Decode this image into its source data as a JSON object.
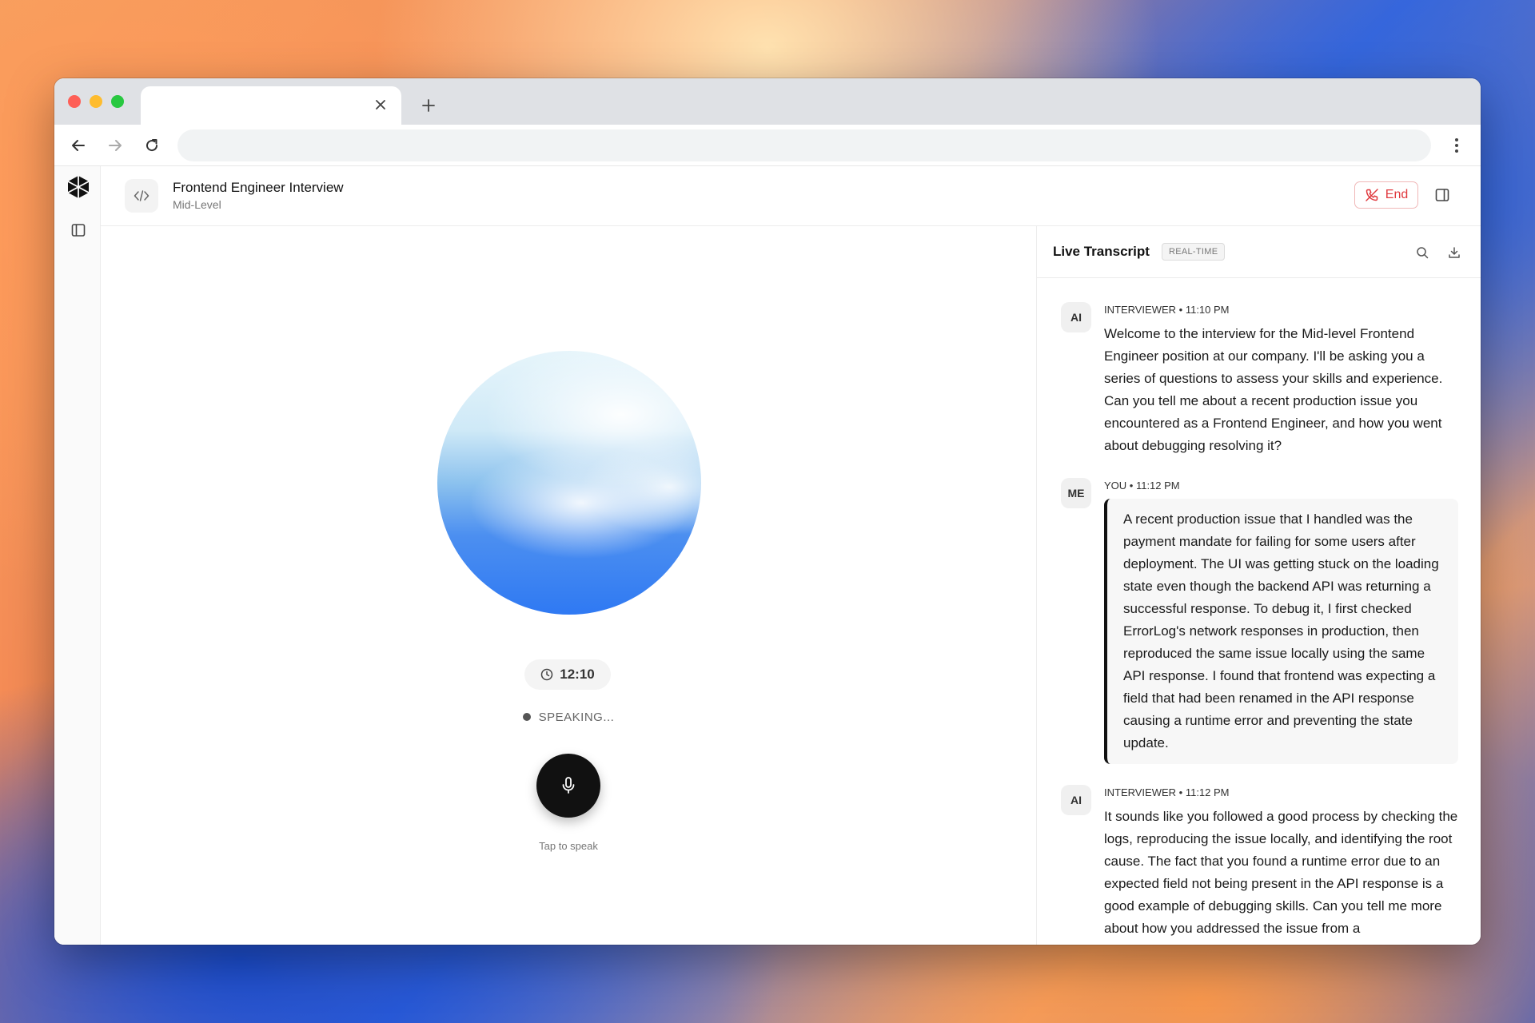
{
  "browser": {
    "tab_title": "",
    "url": ""
  },
  "header": {
    "title": "Frontend Engineer Interview",
    "subtitle": "Mid-Level",
    "end_label": "End"
  },
  "stage": {
    "timer": "12:10",
    "status": "SPEAKING...",
    "mic_hint": "Tap to speak"
  },
  "transcript": {
    "title": "Live Transcript",
    "badge": "REAL-TIME",
    "messages": [
      {
        "avatar": "AI",
        "meta": "INTERVIEWER • 11:10 PM",
        "text": "Welcome to the interview for the Mid-level Frontend Engineer position at our company. I'll be asking you a series of questions to assess your skills and experience. Can you tell me about a recent production issue you encountered as a Frontend Engineer, and how you went about debugging resolving it?"
      },
      {
        "avatar": "ME",
        "meta": "YOU • 11:12 PM",
        "text": "A recent production issue that I handled was the payment mandate for failing for some users after deployment. The UI was getting stuck on the loading state even though the backend API was returning a successful response. To debug it, I first checked ErrorLog's network responses in production, then reproduced the same issue locally using the same API response. I found that frontend was expecting a field that had been renamed in the API response causing a runtime error and preventing the state update."
      },
      {
        "avatar": "AI",
        "meta": "INTERVIEWER • 11:12 PM",
        "text": "It sounds like you followed a good process by checking the logs, reproducing the issue locally, and identifying the root cause. The fact that you found a runtime error due to an expected field not being present in the API response is a good example of debugging skills. Can you tell me more about how you addressed the issue from a"
      }
    ]
  },
  "icons": {
    "tab_close": "close-icon",
    "new_tab": "plus-icon",
    "back": "arrow-left-icon",
    "forward": "arrow-right-icon",
    "reload": "reload-icon",
    "menu": "kebab-menu-icon",
    "logo": "cube-logo-icon",
    "sidebar": "sidebar-toggle-icon",
    "code": "code-icon",
    "end_call": "phone-off-icon",
    "panel": "panel-right-icon",
    "clock": "clock-icon",
    "mic": "microphone-icon",
    "search": "search-icon",
    "download": "download-icon"
  },
  "colors": {
    "end_red": "#e0393e",
    "orb_blue": "#2f79f3",
    "mic_button": "#111111"
  }
}
